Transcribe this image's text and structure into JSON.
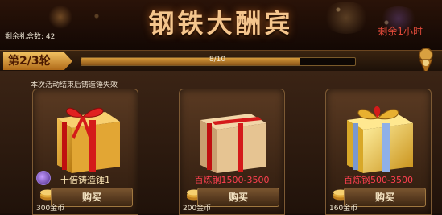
{
  "header": {
    "title": "钢铁大酬宾",
    "boxes_remaining": "剩余礼盒数: 42",
    "time_remaining": "剩余1小时"
  },
  "round": {
    "label": "第2/3轮",
    "progress_text": "8/10",
    "progress_fraction": 0.8
  },
  "notice": "本次活动结束后铸造锤失效",
  "items": [
    {
      "label": "十倍铸造锤1",
      "buy_label": "购买",
      "price": "300金币",
      "box_color": "gold"
    },
    {
      "label": "百炼钢1500-3500",
      "buy_label": "购买",
      "price": "200金币",
      "box_color": "beige"
    },
    {
      "label": "百炼钢500-3500",
      "buy_label": "购买",
      "price": "160金币",
      "box_color": "shiny"
    }
  ],
  "colors": {
    "title": "#f4c58d",
    "time_text": "#e04a3a",
    "item_label": "#ff4050",
    "ribbon": "#d41a1a"
  }
}
